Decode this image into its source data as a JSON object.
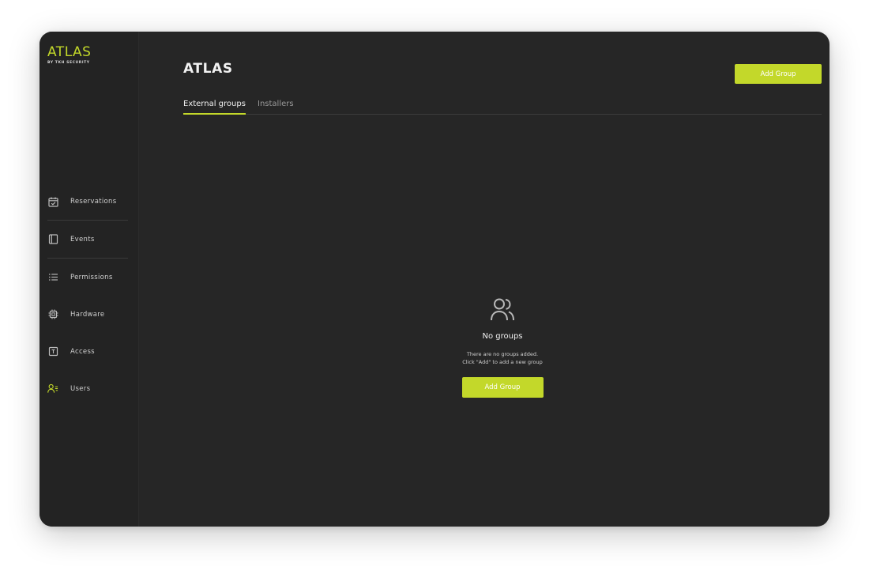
{
  "brand": {
    "name": "ATLAS",
    "tagline": "BY TKH SECURITY"
  },
  "sidebar": {
    "items": [
      {
        "label": "Reservations",
        "icon": "calendar-check-icon"
      },
      {
        "label": "Events",
        "icon": "book-icon"
      },
      {
        "label": "Permissions",
        "icon": "list-icon"
      },
      {
        "label": "Hardware",
        "icon": "chip-icon"
      },
      {
        "label": "Access",
        "icon": "door-icon"
      },
      {
        "label": "Users",
        "icon": "users-icon"
      }
    ]
  },
  "header": {
    "title": "ATLAS",
    "add_button_label": "Add Group"
  },
  "tabs": [
    {
      "label": "External groups",
      "active": true
    },
    {
      "label": "Installers",
      "active": false
    }
  ],
  "empty_state": {
    "icon": "users-icon",
    "title": "No groups",
    "line1": "There are no groups added.",
    "line2": "Click \"Add\" to add a new group",
    "button_label": "Add Group"
  },
  "colors": {
    "accent": "#c3d82a",
    "background": "#262626",
    "sidebar": "#232323"
  }
}
